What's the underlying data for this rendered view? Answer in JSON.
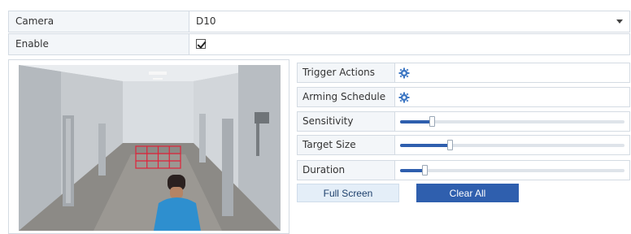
{
  "camera": {
    "label": "Camera",
    "value": "D10"
  },
  "enable": {
    "label": "Enable",
    "checked": true
  },
  "properties": {
    "trigger_actions": "Trigger Actions",
    "arming_schedule": "Arming Schedule",
    "sensitivity": {
      "label": "Sensitivity",
      "level": 0.14
    },
    "target_size": {
      "label": "Target Size",
      "level": 0.22
    },
    "duration": {
      "label": "Duration",
      "level": 0.11
    }
  },
  "buttons": {
    "full_screen": "Full Screen",
    "clear_all": "Clear All"
  },
  "colors": {
    "accent": "#2f5fae",
    "detection_grid": "#e0233a",
    "label_bg": "#f3f6f9"
  },
  "icons": {
    "dropdown": "chevron-down-icon",
    "settings": "gear-icon"
  }
}
